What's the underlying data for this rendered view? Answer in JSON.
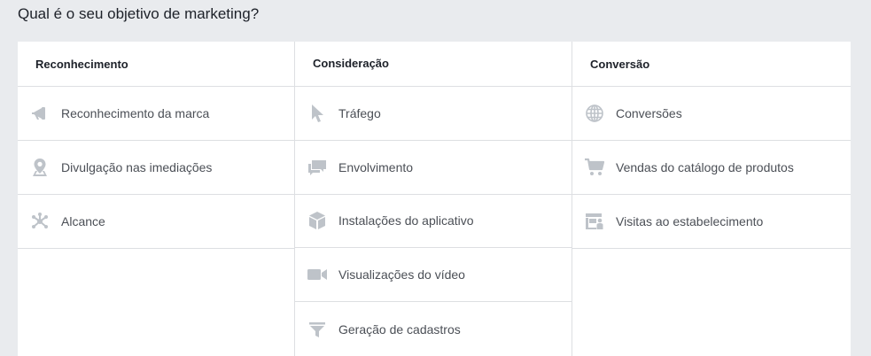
{
  "page": {
    "title": "Qual é o seu objetivo de marketing?"
  },
  "colors": {
    "icon": "#bec3c9",
    "border": "#dddfe2",
    "background": "#e9ebee"
  },
  "columns": [
    {
      "header": "Reconhecimento",
      "items": [
        {
          "label": "Reconhecimento da marca",
          "icon": "megaphone-icon"
        },
        {
          "label": "Divulgação nas imediações",
          "icon": "location-pin-icon"
        },
        {
          "label": "Alcance",
          "icon": "network-icon"
        }
      ]
    },
    {
      "header": "Consideração",
      "items": [
        {
          "label": "Tráfego",
          "icon": "cursor-icon"
        },
        {
          "label": "Envolvimento",
          "icon": "chat-bubbles-icon"
        },
        {
          "label": "Instalações do aplicativo",
          "icon": "box-icon"
        },
        {
          "label": "Visualizações do vídeo",
          "icon": "video-camera-icon"
        },
        {
          "label": "Geração de cadastros",
          "icon": "funnel-icon"
        }
      ]
    },
    {
      "header": "Conversão",
      "items": [
        {
          "label": "Conversões",
          "icon": "globe-icon"
        },
        {
          "label": "Vendas do catálogo de produtos",
          "icon": "shopping-cart-icon"
        },
        {
          "label": "Visitas ao estabelecimento",
          "icon": "store-icon"
        }
      ]
    }
  ]
}
